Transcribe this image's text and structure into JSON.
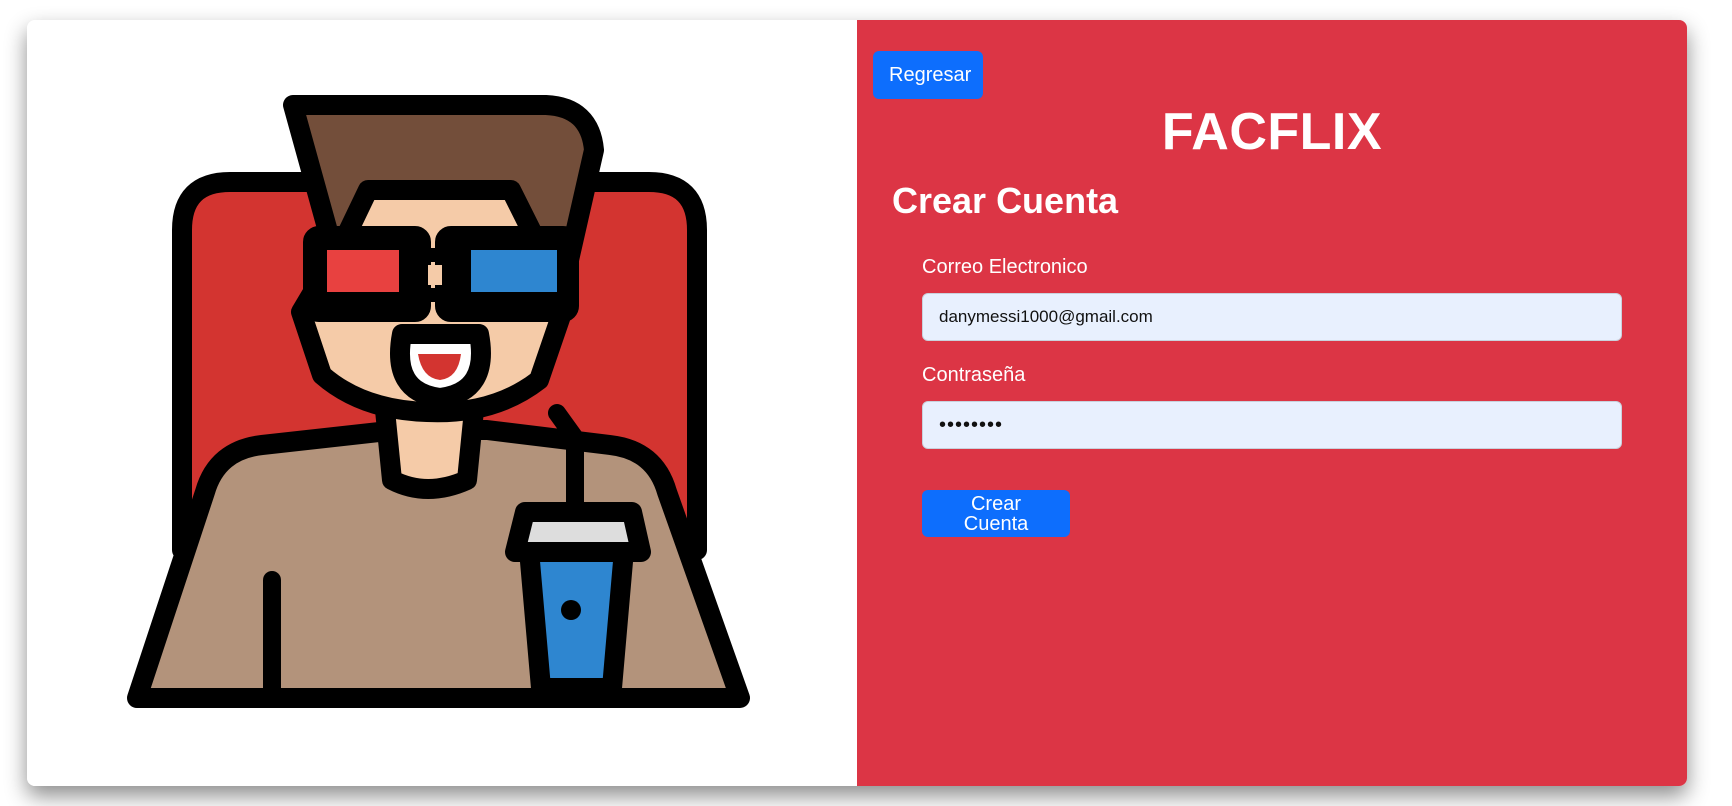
{
  "nav": {
    "back_label": "Regresar"
  },
  "brand": {
    "name": "FACFLIX"
  },
  "form": {
    "title": "Crear Cuenta",
    "email_label": "Correo Electronico",
    "email_value": "danymessi1000@gmail.com",
    "password_label": "Contraseña",
    "password_value": "danymess",
    "submit_label": "Crear Cuenta"
  },
  "illustration": {
    "name": "moviegoer-3d-glasses-illustration"
  },
  "colors": {
    "panel_red": "#dc3545",
    "button_blue": "#0d6efd",
    "input_bg": "#e8f0fe",
    "seat_red": "#d33430",
    "hair_brown": "#734e3a",
    "skin": "#f5cba8",
    "shirt": "#b3937b",
    "lens_red": "#e84140",
    "lens_blue": "#2e86d0"
  }
}
